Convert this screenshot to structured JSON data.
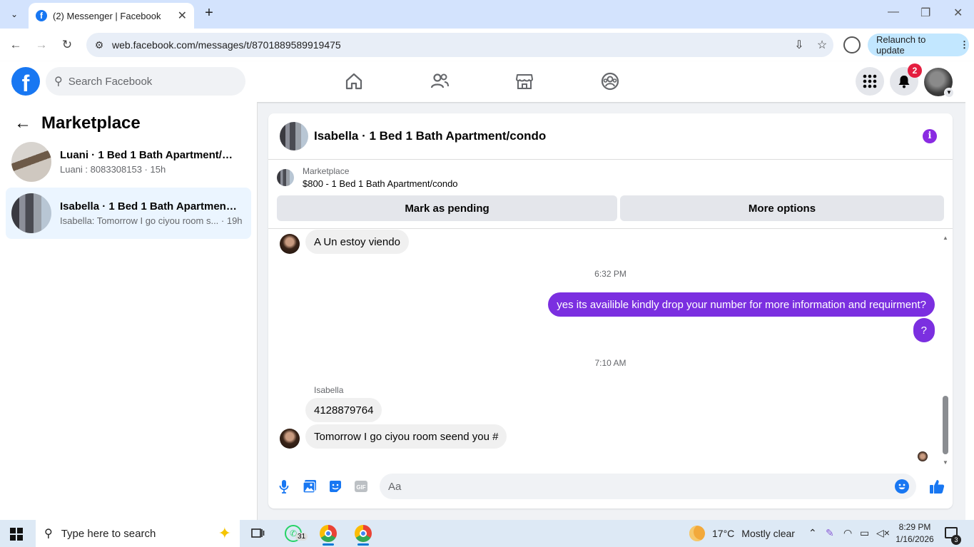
{
  "browser": {
    "tab_title": "(2) Messenger | Facebook",
    "tab_favicon": "f",
    "tab_close": "✕",
    "new_tab": "+",
    "url": "web.facebook.com/messages/t/8701889589919475",
    "relaunch_label": "Relaunch to update",
    "relaunch_menu": "⋮",
    "window_controls": [
      "—",
      "❐",
      "✕"
    ]
  },
  "fb_header": {
    "logo": "f",
    "search_placeholder": "Search Facebook",
    "notification_count": "2"
  },
  "sidebar": {
    "title": "Marketplace",
    "back": "←",
    "conversations": [
      {
        "name": "Luani · 1 Bed 1 Bath Apartment/condo",
        "preview": "Luani : 8083308153 · 15h",
        "active": false
      },
      {
        "name": "Isabella · 1 Bed 1 Bath Apartment/condo",
        "preview": "Isabella: Tomorrow I go ciyou room s... · 19h",
        "active": true
      }
    ]
  },
  "chat": {
    "title": "Isabella · 1 Bed 1 Bath Apartment/condo",
    "info_icon": "i",
    "listing_label": "Marketplace",
    "listing_price": "$800 - 1 Bed 1 Bath Apartment/condo",
    "mark_pending": "Mark as pending",
    "more_options": "More options",
    "messages": [
      {
        "dir": "in",
        "text": "A Un estoy viendo"
      },
      {
        "timestamp": "6:32 PM"
      },
      {
        "dir": "out",
        "text": "yes its availible kindly drop your number for more information and requirment?"
      },
      {
        "dir": "out",
        "text": "?"
      },
      {
        "timestamp": "7:10 AM"
      },
      {
        "sender": "Isabella"
      },
      {
        "dir": "in",
        "text": "4128879764"
      },
      {
        "dir": "in",
        "text": "Tomorrow I go ciyou  room  seend you #"
      }
    ],
    "composer_placeholder": "Aa",
    "gif_label": "GIF",
    "accent_color": "#7b2fe0"
  },
  "taskbar": {
    "search_placeholder": "Type here to search",
    "whatsapp_badge": "31",
    "weather_temp": "17°C",
    "weather_text": "Mostly clear",
    "time": "8:29 PM",
    "date": "1/16/2026",
    "notification_count": "3"
  }
}
